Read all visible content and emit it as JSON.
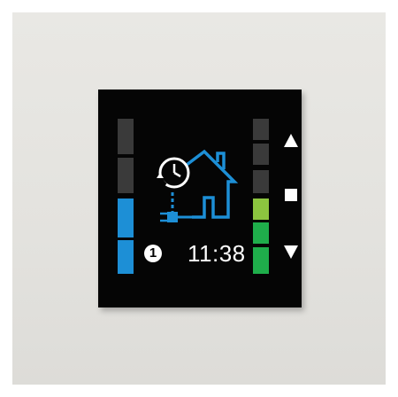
{
  "device": {
    "mode_number": "1",
    "time": "11:38"
  },
  "left_indicator": {
    "segments": [
      "off",
      "off",
      "blue",
      "blue"
    ],
    "color_active": "#1d8fd6",
    "color_off": "#3a3a3a"
  },
  "right_indicator": {
    "segments": [
      "off",
      "off",
      "off",
      "light-green",
      "green",
      "green"
    ],
    "color_light_green": "#8cc53f",
    "color_green": "#1fae4b"
  },
  "icons": {
    "up": "arrow-up-icon",
    "stop": "stop-square-icon",
    "down": "arrow-down-icon",
    "status": "house-schedule-plug-icon"
  },
  "accent_blue": "#1d8fd6",
  "panel_color": "#050505"
}
